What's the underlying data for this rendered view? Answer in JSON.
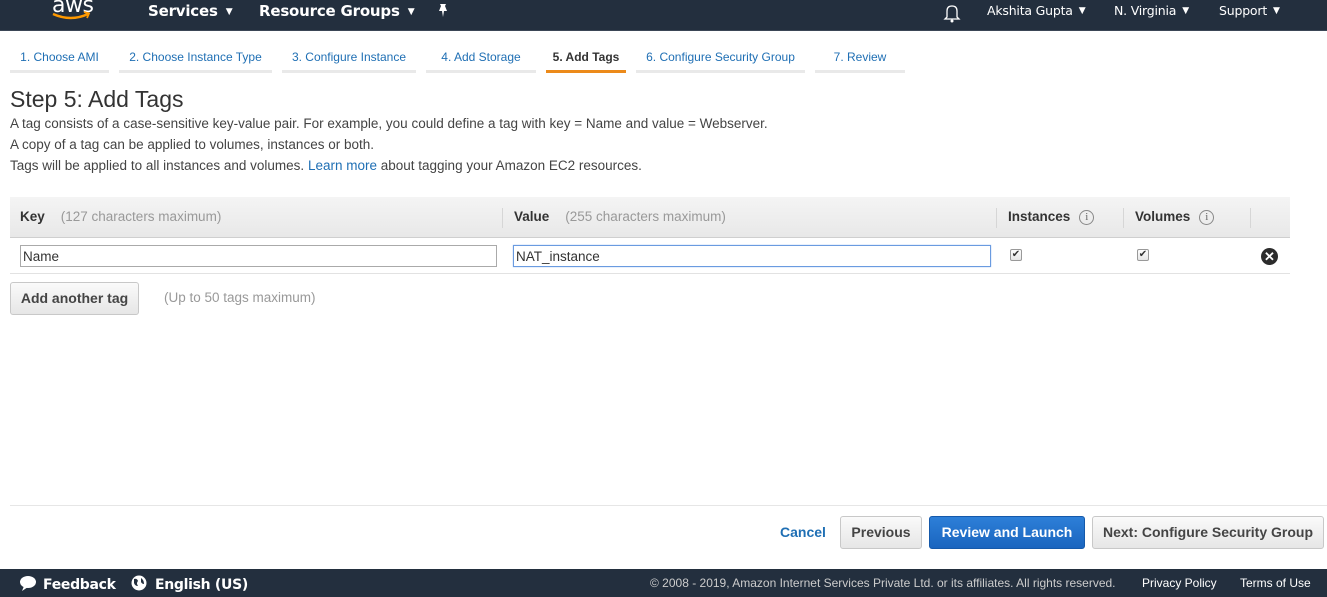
{
  "topnav": {
    "logo_text": "aws",
    "services": "Services",
    "resource_groups": "Resource Groups",
    "user": "Akshita Gupta",
    "region": "N. Virginia",
    "support": "Support",
    "icons": [
      "pin-icon",
      "bell-icon"
    ]
  },
  "wizard": {
    "tabs": [
      {
        "label": "1. Choose AMI",
        "active": false
      },
      {
        "label": "2. Choose Instance Type",
        "active": false
      },
      {
        "label": "3. Configure Instance",
        "active": false
      },
      {
        "label": "4. Add Storage",
        "active": false
      },
      {
        "label": "5. Add Tags",
        "active": true
      },
      {
        "label": "6. Configure Security Group",
        "active": false
      },
      {
        "label": "7. Review",
        "active": false
      }
    ]
  },
  "page": {
    "title": "Step 5: Add Tags",
    "desc1": "A tag consists of a case-sensitive key-value pair. For example, you could define a tag with key = Name and value = Webserver.",
    "desc2": "A copy of a tag can be applied to volumes, instances or both.",
    "desc3_pre": "Tags will be applied to all instances and volumes.",
    "desc3_link": "Learn more",
    "desc3_post": "about tagging your Amazon EC2 resources."
  },
  "table": {
    "columns": {
      "key": {
        "label": "Key",
        "hint": "(127 characters maximum)"
      },
      "value": {
        "label": "Value",
        "hint": "(255 characters maximum)"
      },
      "instances": {
        "label": "Instances"
      },
      "volumes": {
        "label": "Volumes"
      }
    },
    "rows": [
      {
        "key": "Name",
        "value": "NAT_instance",
        "instances": true,
        "volumes": true
      }
    ]
  },
  "actions": {
    "add_tag": "Add another tag",
    "add_tag_note": "(Up to 50 tags maximum)",
    "cancel": "Cancel",
    "previous": "Previous",
    "review_launch": "Review and Launch",
    "next": "Next: Configure Security Group"
  },
  "colors": {
    "nav_bg": "#232f3e",
    "link": "#1f6fb4",
    "active_tab": "#ec8a1a",
    "primary": "#1a65bf"
  },
  "footer": {
    "feedback": "Feedback",
    "language": "English (US)",
    "copyright": "© 2008 - 2019, Amazon Internet Services Private Ltd. or its affiliates. All rights reserved.",
    "privacy": "Privacy Policy",
    "terms": "Terms of Use"
  }
}
